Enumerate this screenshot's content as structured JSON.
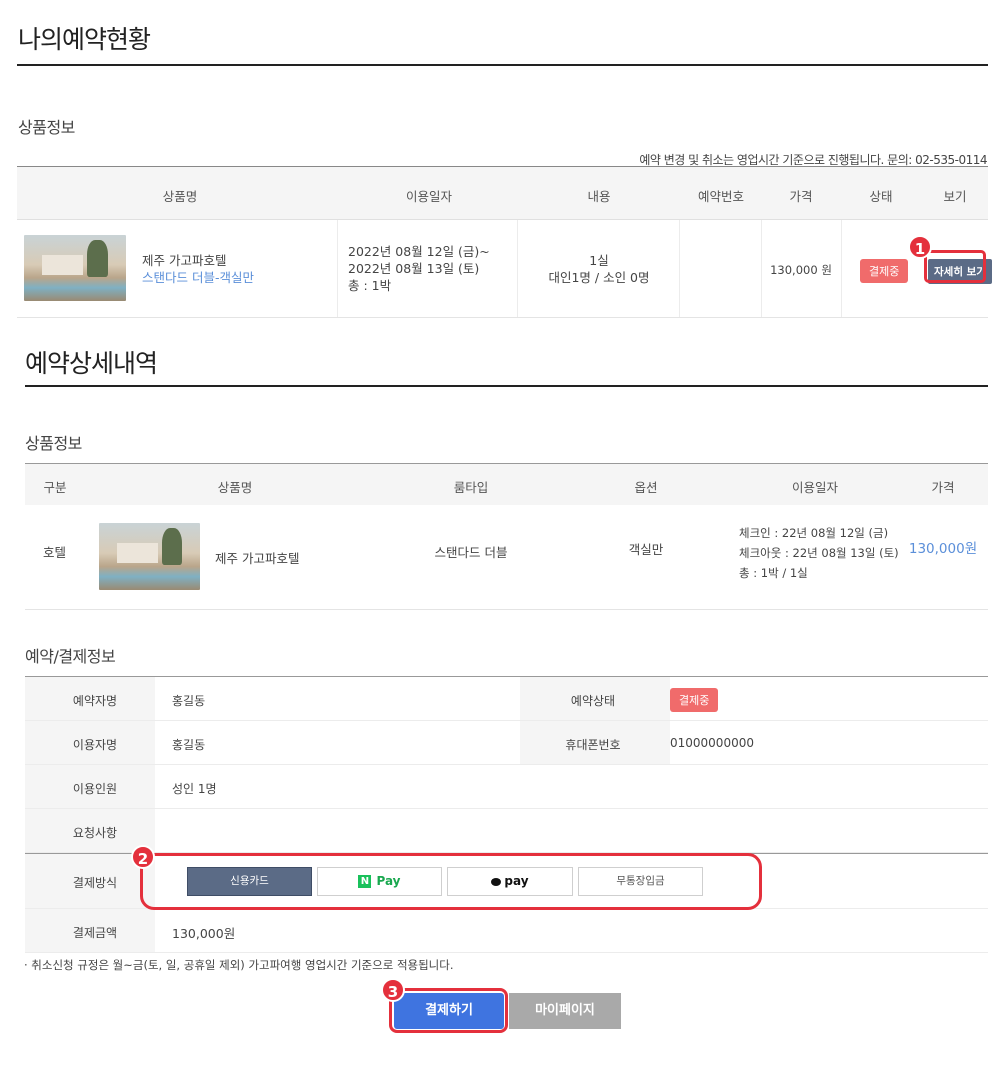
{
  "page": {
    "title": "나의예약현황",
    "section_product_info": "상품정보",
    "notice": "예약 변경 및 취소는 영업시간 기준으로 진행됩니다. 문의: 02-535-0114"
  },
  "summary_table": {
    "headers": [
      "상품명",
      "이용일자",
      "내용",
      "예약번호",
      "가격",
      "상태",
      "보기"
    ],
    "row": {
      "hotel_name": "제주 가고파호텔",
      "room": "스탠다드 더블-객실만",
      "date_line1": "2022년 08월 12일 (금)~",
      "date_line2": "2022년 08월 13일 (토)",
      "date_line3": "총 : 1박",
      "content_line1": "1실",
      "content_line2": "대인1명 / 소인 0명",
      "reservation_no": "",
      "price": "130,000 원",
      "status": "결제중",
      "view_button": "자세히 보기"
    }
  },
  "markers": [
    "1",
    "2",
    "3"
  ],
  "detail": {
    "title": "예약상세내역",
    "section_product_info": "상품정보",
    "headers": [
      "구분",
      "상품명",
      "룸타입",
      "옵션",
      "이용일자",
      "가격"
    ],
    "row": {
      "category": "호텔",
      "hotel_name": "제주 가고파호텔",
      "room_type": "스탠다드 더블",
      "option": "객실만",
      "checkin": "체크인 : 22년 08월 12일 (금)",
      "checkout": "체크아웃 : 22년 08월 13일 (토)",
      "nights": "총 : 1박 / 1실",
      "price": "130,000원"
    }
  },
  "payment_info": {
    "title": "예약/결제정보",
    "reserver_label": "예약자명",
    "reserver_value": "홍길동",
    "status_label": "예약상태",
    "status_value": "결제중",
    "user_label": "이용자명",
    "user_value": "홍길동",
    "phone_label": "휴대폰번호",
    "phone_value": "01000000000",
    "people_label": "이용인원",
    "people_value": "성인 1명",
    "request_label": "요청사항",
    "request_value": "",
    "method_label": "결제방식",
    "methods": {
      "card": "신용카드",
      "npay_logo": "N",
      "npay": "Pay",
      "kakaopay": "pay",
      "bank": "무통장입금"
    },
    "amount_label": "결제금액",
    "amount_value": "130,000원"
  },
  "footnote": "· 취소신청 규정은 월~금(토, 일, 공휴일 제외) 가고파여행 영업시간 기준으로 적용됩니다.",
  "actions": {
    "pay": "결제하기",
    "mypage": "마이페이지"
  },
  "colors": {
    "accent_blue": "#3f74e0",
    "status_red": "#f06b6b",
    "marker_red": "#e4303c",
    "active_method": "#5b6b86"
  }
}
